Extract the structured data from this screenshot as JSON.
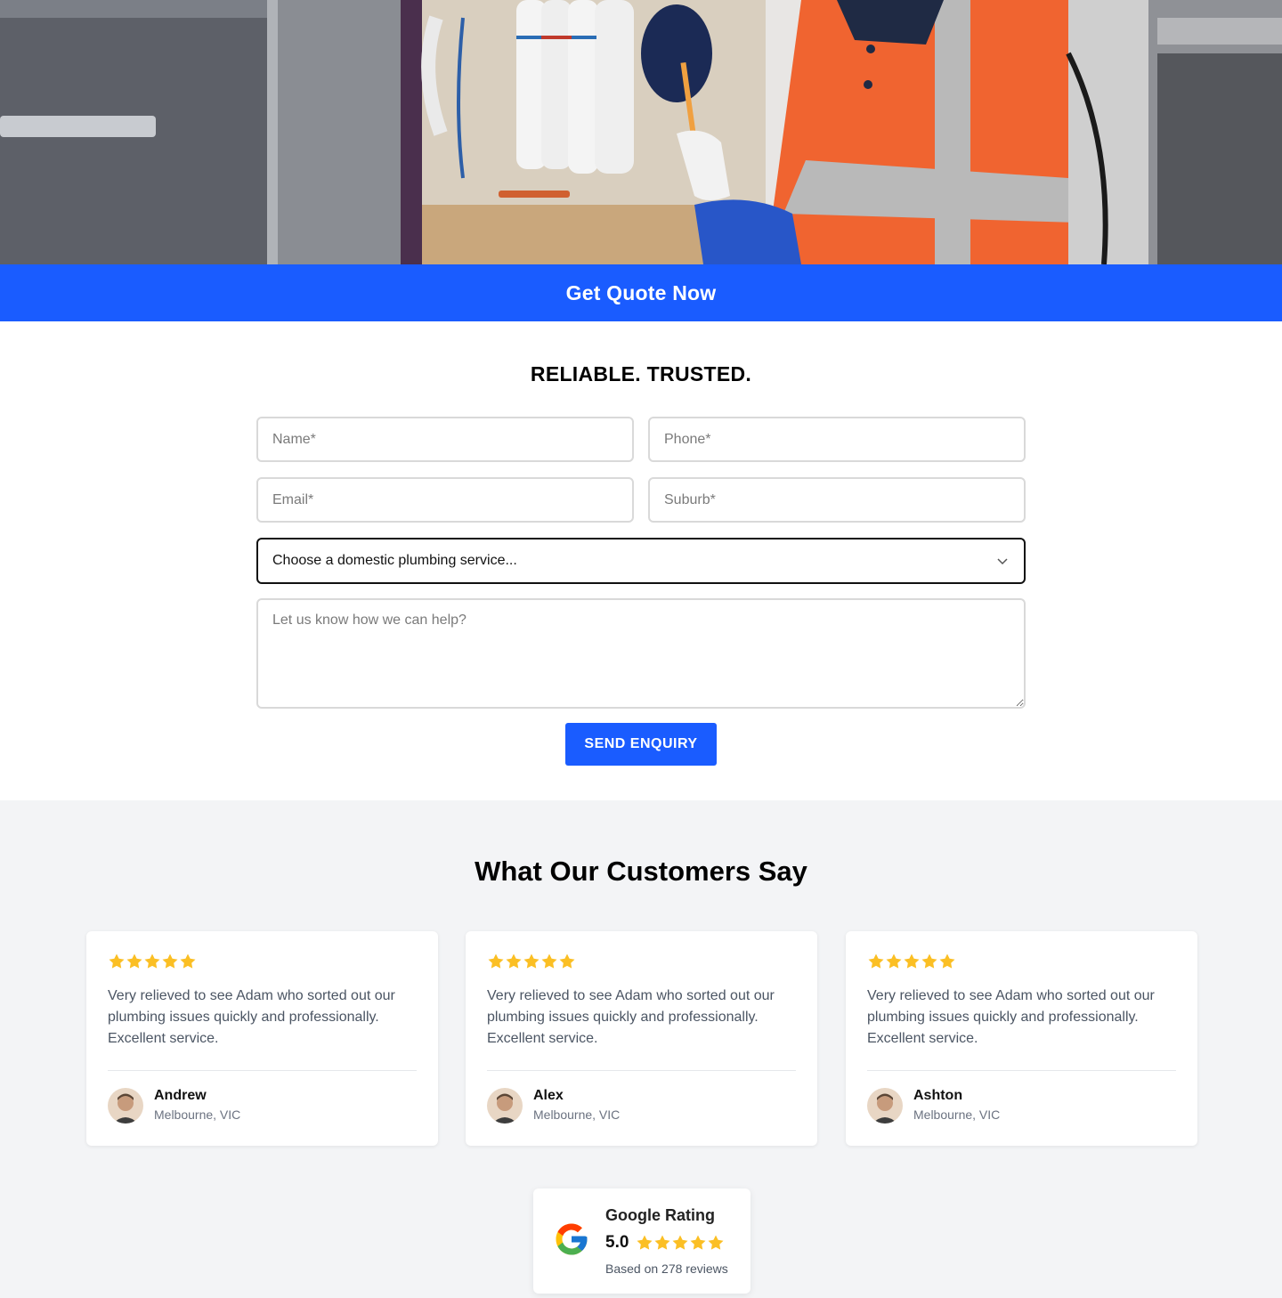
{
  "hero": {
    "image_alt": "plumber-under-sink",
    "cta_label": "Get Quote Now"
  },
  "form": {
    "title": "RELIABLE. TRUSTED.",
    "name_placeholder": "Name*",
    "phone_placeholder": "Phone*",
    "email_placeholder": "Email*",
    "suburb_placeholder": "Suburb*",
    "service_selected": "Choose a domestic plumbing service...",
    "message_placeholder": "Let us know how we can help?",
    "submit_label": "SEND ENQUIRY"
  },
  "reviews": {
    "title": "What Our Customers Say",
    "star_color": "#fbbf24",
    "items": [
      {
        "rating": 5,
        "text": "Very relieved to see Adam who sorted out our plumbing issues quickly and professionally. Excellent service.",
        "name": "Andrew",
        "location": "Melbourne, VIC"
      },
      {
        "rating": 5,
        "text": "Very relieved to see Adam who sorted out our plumbing issues quickly and professionally. Excellent service.",
        "name": "Alex",
        "location": "Melbourne, VIC"
      },
      {
        "rating": 5,
        "text": "Very relieved to see Adam who sorted out our plumbing issues quickly and professionally. Excellent service.",
        "name": "Ashton",
        "location": "Melbourne, VIC"
      }
    ]
  },
  "google": {
    "title": "Google Rating",
    "score": "5.0",
    "based_on": "Based on 278 reviews",
    "rating": 5
  },
  "colors": {
    "brand_blue": "#1a5cff",
    "section_bg": "#f3f4f6"
  }
}
